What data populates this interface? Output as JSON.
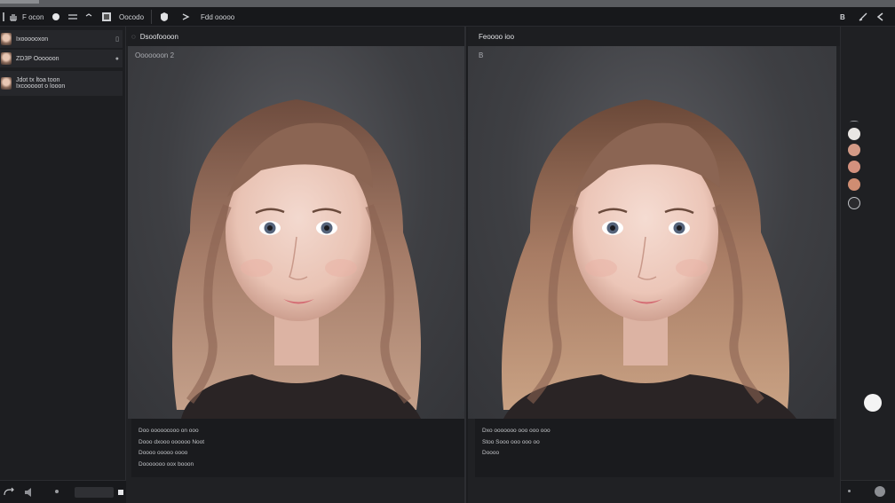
{
  "toolbar": {
    "file_label": "F ocon",
    "mode_label": "Oocodo",
    "path_label": "Fdd ooooo",
    "right_icon_label": "B"
  },
  "layers": [
    {
      "label": "Ixoooooxon"
    },
    {
      "label": "ZD3P Oooooon"
    },
    {
      "line1": "Jdot tx ltoa toon",
      "line2": "Ixcooooot o looon"
    }
  ],
  "left_panel": {
    "title": "Dsoofoooon",
    "corner_label": "Ooooooon 2",
    "info_lines": [
      "Doo ooooocooo on ooo",
      "Dooo dxooo oooooo Noot",
      "Doooo ooooo oooo",
      "Dooooooo oox booon"
    ]
  },
  "right_panel": {
    "title": "Feoooo ioo",
    "corner_label": "B",
    "info_lines": [
      "Dxo ooooooo ooo ooo ooo",
      "Stoo Sooo ooo ooo oo",
      "Doooo"
    ]
  },
  "colors": {
    "accent": "#f4f4f4",
    "swatches": [
      "#e9e6e3",
      "#d39a86",
      "#d4917e",
      "#cf8d72",
      "#2b2b2e"
    ]
  }
}
